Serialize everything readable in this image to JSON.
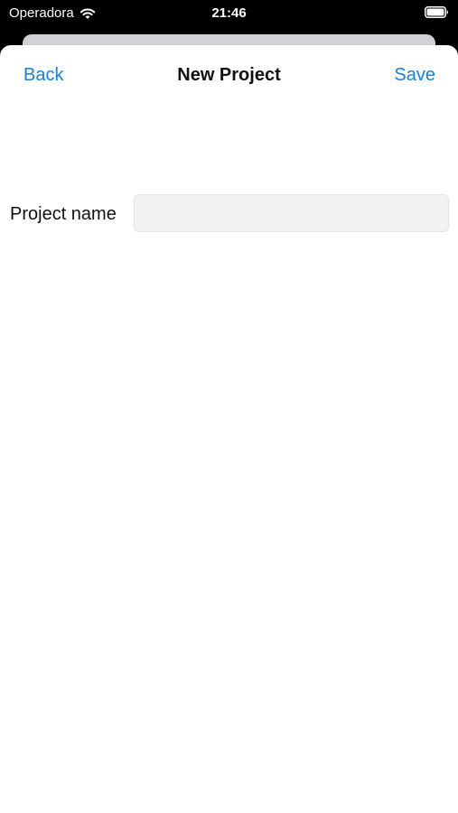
{
  "status_bar": {
    "carrier": "Operadora",
    "time": "21:46"
  },
  "nav": {
    "back_label": "Back",
    "title": "New Project",
    "save_label": "Save"
  },
  "form": {
    "project_name_label": "Project name",
    "project_name_value": "",
    "project_name_placeholder": ""
  },
  "colors": {
    "accent": "#1a80d8",
    "input_background": "#f2f2f2",
    "sheet_background": "#ffffff",
    "status_bar_background": "#000000"
  },
  "icons": {
    "wifi": "wifi-icon",
    "battery": "battery-icon"
  }
}
